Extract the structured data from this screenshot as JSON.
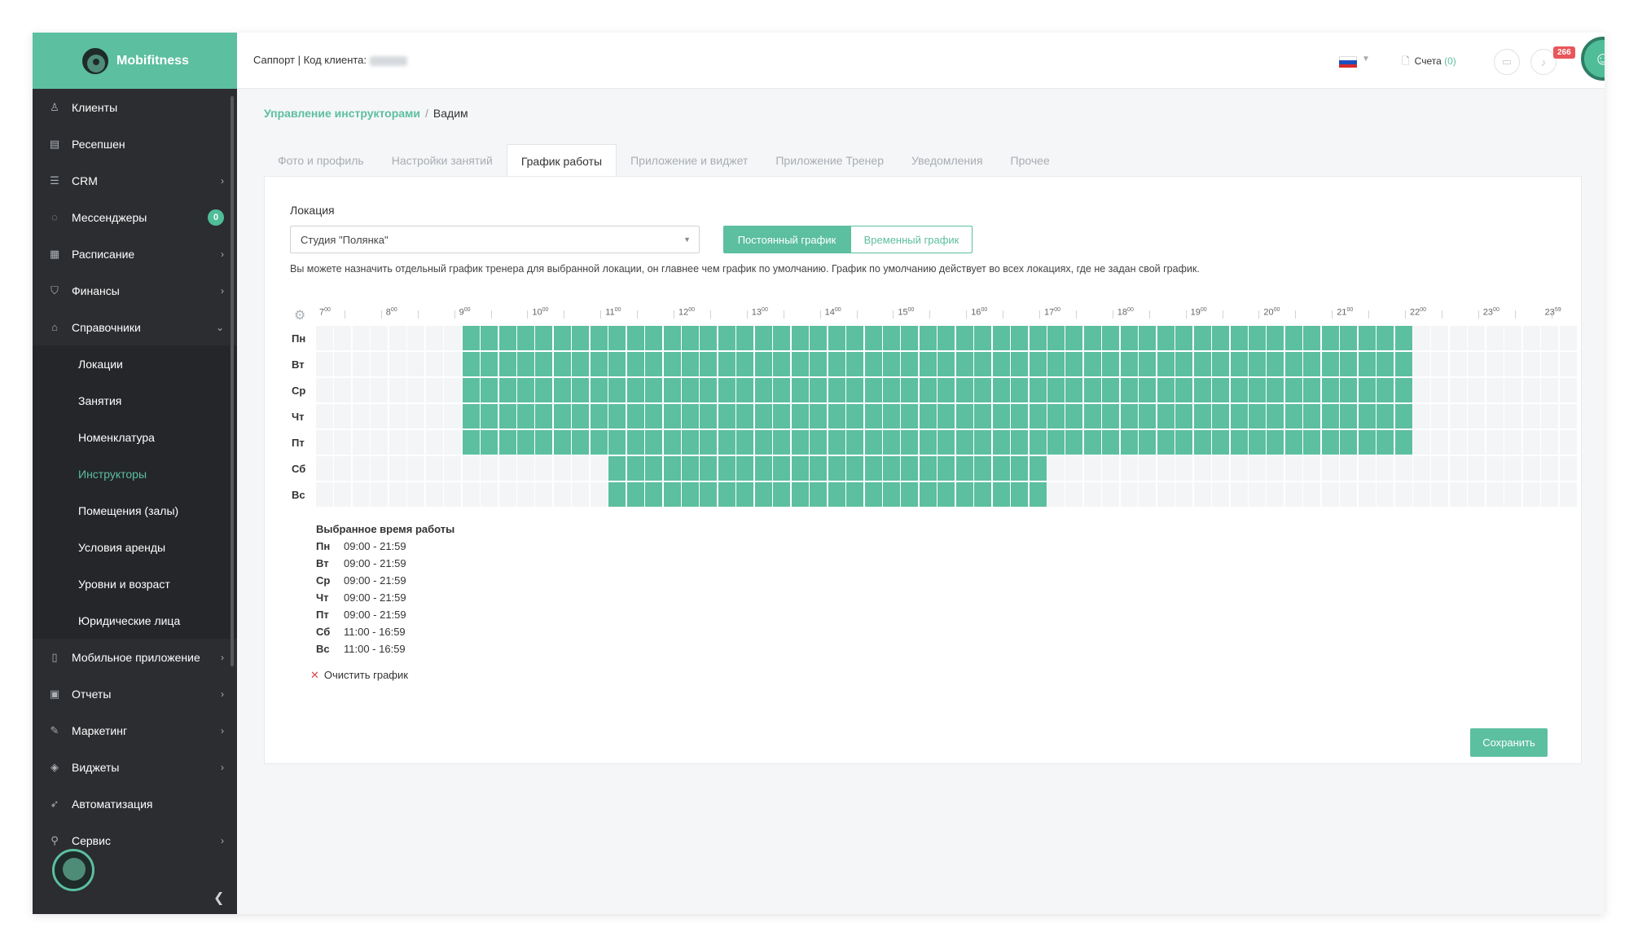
{
  "brand": {
    "name": "Mobifitness"
  },
  "topbar": {
    "support_text": "Саппорт | Код клиента:",
    "bills_label": "Счета",
    "bills_count": "(0)",
    "notifications_count": "266"
  },
  "sidebar": {
    "items": [
      {
        "label": "Клиенты",
        "icon": "user-icon"
      },
      {
        "label": "Ресепшен",
        "icon": "clipboard-icon"
      },
      {
        "label": "CRM",
        "icon": "list-icon",
        "chevron": true
      },
      {
        "label": "Мессенджеры",
        "icon": "chat-icon",
        "badge": "0"
      },
      {
        "label": "Расписание",
        "icon": "calendar-icon",
        "chevron": true
      },
      {
        "label": "Финансы",
        "icon": "cart-icon",
        "chevron": true
      },
      {
        "label": "Справочники",
        "icon": "home-icon",
        "chevron": true,
        "expanded": true
      }
    ],
    "subitems": [
      {
        "label": "Локации"
      },
      {
        "label": "Занятия"
      },
      {
        "label": "Номенклатура"
      },
      {
        "label": "Инструкторы",
        "active": true
      },
      {
        "label": "Помещения (залы)"
      },
      {
        "label": "Условия аренды"
      },
      {
        "label": "Уровни и возраст"
      },
      {
        "label": "Юридические лица"
      }
    ],
    "items_after": [
      {
        "label": "Мобильное приложение",
        "icon": "phone-icon",
        "chevron": true
      },
      {
        "label": "Отчеты",
        "icon": "report-icon",
        "chevron": true
      },
      {
        "label": "Маркетинг",
        "icon": "megaphone-icon",
        "chevron": true
      },
      {
        "label": "Виджеты",
        "icon": "puzzle-icon",
        "chevron": true
      },
      {
        "label": "Автоматизация",
        "icon": "rocket-icon"
      },
      {
        "label": "Сервис",
        "icon": "wrench-icon",
        "chevron": true
      }
    ]
  },
  "breadcrumb": {
    "parent": "Управление инструкторами",
    "current": "Вадим"
  },
  "tabs": [
    {
      "label": "Фото и профиль"
    },
    {
      "label": "Настройки занятий"
    },
    {
      "label": "График работы",
      "active": true
    },
    {
      "label": "Приложение и виджет"
    },
    {
      "label": "Приложение Тренер"
    },
    {
      "label": "Уведомления"
    },
    {
      "label": "Прочее"
    }
  ],
  "schedule": {
    "location_label": "Локация",
    "location_value": "Студия \"Полянка\"",
    "btn_permanent": "Постоянный график",
    "btn_temporary": "Временный график",
    "hint": "Вы можете назначить отдельный график тренера для выбранной локации, он главнее чем график по умолчанию. График по умолчанию действует во всех локациях, где не задан свой график.",
    "hour_labels": [
      {
        "h": "7",
        "m": "00"
      },
      {
        "h": "8",
        "m": "00"
      },
      {
        "h": "9",
        "m": "00"
      },
      {
        "h": "10",
        "m": "00"
      },
      {
        "h": "11",
        "m": "00"
      },
      {
        "h": "12",
        "m": "00"
      },
      {
        "h": "13",
        "m": "00"
      },
      {
        "h": "14",
        "m": "00"
      },
      {
        "h": "15",
        "m": "00"
      },
      {
        "h": "16",
        "m": "00"
      },
      {
        "h": "17",
        "m": "00"
      },
      {
        "h": "18",
        "m": "00"
      },
      {
        "h": "19",
        "m": "00"
      },
      {
        "h": "20",
        "m": "00"
      },
      {
        "h": "21",
        "m": "00"
      },
      {
        "h": "22",
        "m": "00"
      },
      {
        "h": "23",
        "m": "00"
      },
      {
        "h": "23",
        "m": "59"
      }
    ],
    "days": [
      {
        "label": "Пн",
        "start": 9,
        "end": 22
      },
      {
        "label": "Вт",
        "start": 9,
        "end": 22
      },
      {
        "label": "Ср",
        "start": 9,
        "end": 22
      },
      {
        "label": "Чт",
        "start": 9,
        "end": 22
      },
      {
        "label": "Пт",
        "start": 9,
        "end": 22
      },
      {
        "label": "Сб",
        "start": 11,
        "end": 17
      },
      {
        "label": "Вс",
        "start": 11,
        "end": 17
      }
    ],
    "selected_title": "Выбранное время работы",
    "selected": [
      {
        "day": "Пн",
        "range": "09:00 - 21:59"
      },
      {
        "day": "Вт",
        "range": "09:00 - 21:59"
      },
      {
        "day": "Ср",
        "range": "09:00 - 21:59"
      },
      {
        "day": "Чт",
        "range": "09:00 - 21:59"
      },
      {
        "day": "Пт",
        "range": "09:00 - 21:59"
      },
      {
        "day": "Сб",
        "range": "11:00 - 16:59"
      },
      {
        "day": "Вс",
        "range": "11:00 - 16:59"
      }
    ],
    "clear_label": "Очистить график",
    "save_label": "Сохранить"
  },
  "colors": {
    "accent": "#5cbf9f",
    "sidebar": "#2b2d30",
    "danger": "#e0474c"
  }
}
